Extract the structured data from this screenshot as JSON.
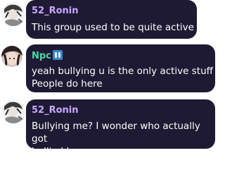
{
  "messages": [
    {
      "sender": "52_Ronin",
      "sender_color": "#c9a9ff",
      "text": "This group used to be quite active"
    },
    {
      "sender": "Npc",
      "sender_color": "#4dd6a8",
      "badge_icon": "x-ray-sticker-icon",
      "text": "yeah bullying u is the only active stuff\nPeople do here"
    },
    {
      "sender": "52_Ronin",
      "sender_color": "#c9a9ff",
      "text": "Bullying me? I wonder who actually got\nbullied here"
    }
  ]
}
